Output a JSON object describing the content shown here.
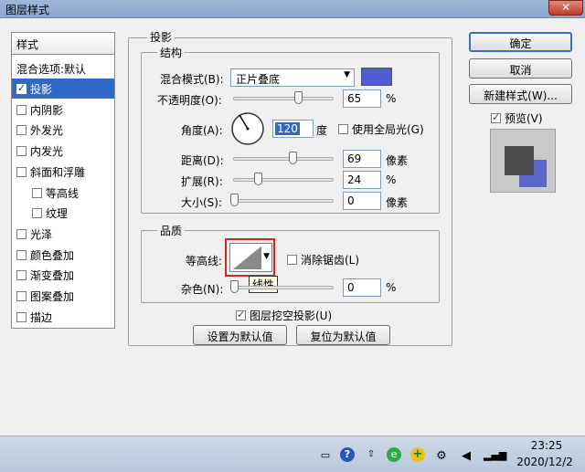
{
  "window": {
    "title": "图层样式",
    "close_glyph": "✕"
  },
  "left_panel": {
    "header": "样式",
    "blend_options": "混合选项:默认",
    "items": [
      {
        "label": "投影",
        "checked": true,
        "selected": true
      },
      {
        "label": "内阴影",
        "checked": false
      },
      {
        "label": "外发光",
        "checked": false
      },
      {
        "label": "内发光",
        "checked": false
      },
      {
        "label": "斜面和浮雕",
        "checked": false
      },
      {
        "label": "等高线",
        "checked": false,
        "sub": true
      },
      {
        "label": "纹理",
        "checked": false,
        "sub": true
      },
      {
        "label": "光泽",
        "checked": false
      },
      {
        "label": "颜色叠加",
        "checked": false
      },
      {
        "label": "渐变叠加",
        "checked": false
      },
      {
        "label": "图案叠加",
        "checked": false
      },
      {
        "label": "描边",
        "checked": false
      }
    ]
  },
  "shadow_section": {
    "title": "投影",
    "structure": {
      "title": "结构",
      "blend_mode_label": "混合模式(B):",
      "blend_mode_value": "正片叠底",
      "blend_color": "#4f5bd0",
      "opacity_label": "不透明度(O):",
      "opacity_value": "65",
      "opacity_unit": "%",
      "angle_label": "角度(A):",
      "angle_value": "120",
      "angle_unit": "度",
      "global_light_label": "使用全局光(G)",
      "global_light_checked": false,
      "distance_label": "距离(D):",
      "distance_value": "69",
      "distance_unit": "像素",
      "spread_label": "扩展(R):",
      "spread_value": "24",
      "spread_unit": "%",
      "size_label": "大小(S):",
      "size_value": "0",
      "size_unit": "像素"
    },
    "quality": {
      "title": "品质",
      "contour_label": "等高线:",
      "antialias_label": "消除锯齿(L)",
      "antialias_checked": false,
      "tooltip": "线性",
      "noise_label": "杂色(N):",
      "noise_value": "0",
      "noise_unit": "%"
    },
    "knockout_label": "图层挖空投影(U)",
    "knockout_checked": true,
    "make_default_label": "设置为默认值",
    "reset_default_label": "复位为默认值"
  },
  "right_buttons": {
    "ok": "确定",
    "cancel": "取消",
    "new_style": "新建样式(W)...",
    "preview_label": "预览(V)",
    "preview_checked": true
  },
  "taskbar": {
    "time": "23:25",
    "date": "2020/12/2",
    "icons": [
      "keyboard-icon",
      "help-icon",
      "flag-icon",
      "browser-icon",
      "add-icon",
      "network-icon",
      "volume-icon",
      "signal-icon"
    ]
  },
  "colors": {
    "accent": "#3169c6",
    "shadow_color": "#4f5bd0",
    "contour_highlight": "#d9261c"
  }
}
